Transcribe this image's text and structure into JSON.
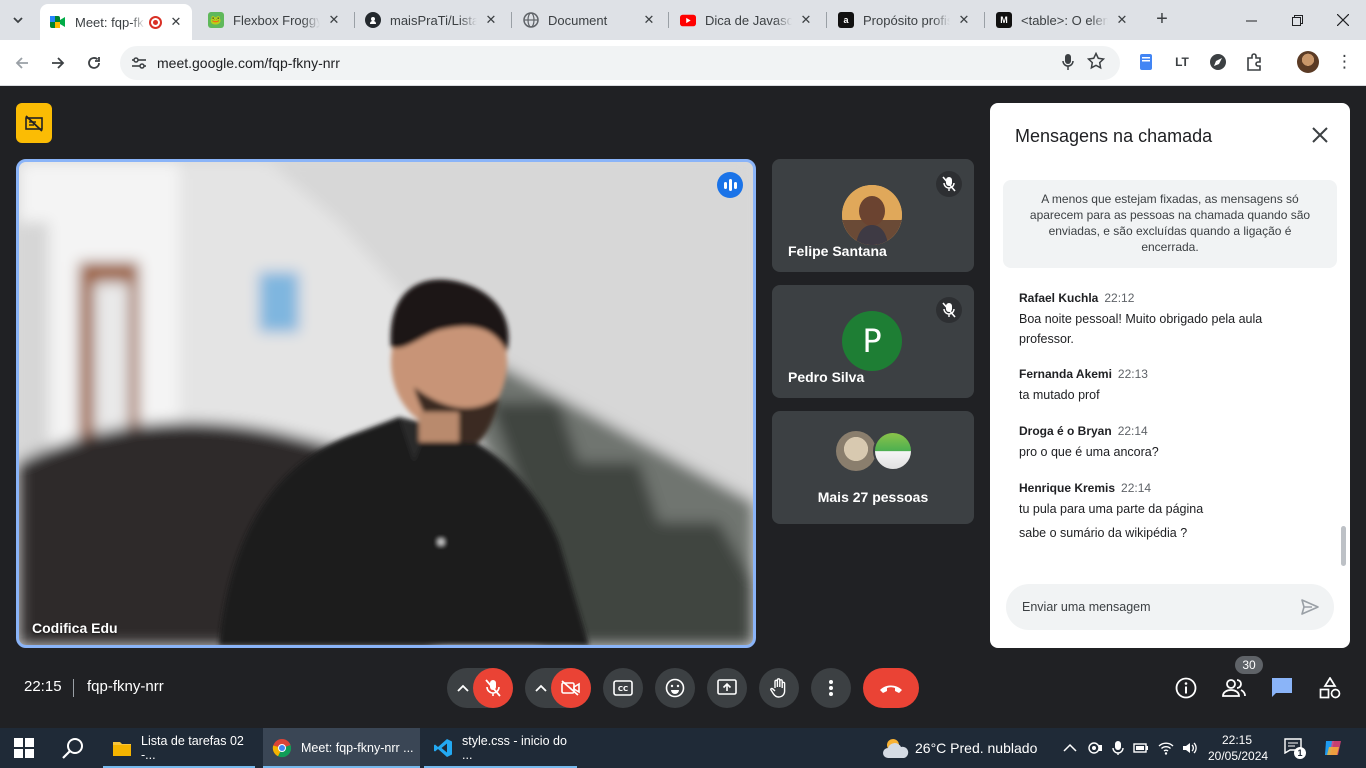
{
  "browser": {
    "tabs": [
      {
        "title": "Meet: fqp-fk",
        "favicon": "google-meet-icon",
        "active": true
      },
      {
        "title": "Flexbox Froggy",
        "favicon": "frog-icon"
      },
      {
        "title": "maisPraTi/Listas",
        "favicon": "github-icon"
      },
      {
        "title": "Document",
        "favicon": "globe-icon"
      },
      {
        "title": "Dica de Javascript",
        "favicon": "youtube-icon"
      },
      {
        "title": "Propósito profis",
        "favicon": "a-icon"
      },
      {
        "title": "<table>: O elem",
        "favicon": "mdn-icon"
      }
    ],
    "new_tab": "+",
    "url": "meet.google.com/fqp-fkny-nrr"
  },
  "meet": {
    "main_participant": "Codifica Edu",
    "participants": [
      {
        "name": "Felipe Santana",
        "muted": true
      },
      {
        "name": "Pedro Silva",
        "initial": "P",
        "muted": true,
        "avatar_color": "#1e7e34"
      }
    ],
    "more": "Mais 27 pessoas",
    "time": "22:15",
    "meeting_code": "fqp-fkny-nrr",
    "people_count": "30"
  },
  "chat": {
    "title": "Mensagens na chamada",
    "notice": "A menos que estejam fixadas, as mensagens só aparecem para as pessoas na chamada quando são enviadas, e são excluídas quando a ligação é encerrada.",
    "messages": [
      {
        "author": "Rafael Kuchla",
        "time": "22:12",
        "lines": [
          "Boa noite pessoal! Muito obrigado pela aula professor."
        ]
      },
      {
        "author": "Fernanda Akemi",
        "time": "22:13",
        "lines": [
          "ta mutado prof"
        ]
      },
      {
        "author": "Droga é o Bryan",
        "time": "22:14",
        "lines": [
          "pro o que é uma ancora?"
        ]
      },
      {
        "author": "Henrique Kremis",
        "time": "22:14",
        "lines": [
          "tu pula para uma parte da página",
          "sabe o sumário da wikipédia ?"
        ]
      }
    ],
    "input_placeholder": "Enviar uma mensagem"
  },
  "taskbar": {
    "apps": [
      {
        "label": "Lista de tarefas 02 -...",
        "icon": "folder-icon"
      },
      {
        "label": "Meet: fqp-fkny-nrr ...",
        "icon": "chrome-icon",
        "active": true
      },
      {
        "label": "style.css - inicio do ...",
        "icon": "vscode-icon"
      }
    ],
    "weather": "26°C  Pred. nublado",
    "time": "22:15",
    "date": "20/05/2024",
    "notifications": "1"
  },
  "colors": {
    "meet_bg": "#202124",
    "tile_bg": "#3c4043",
    "end_call": "#ea4335",
    "active_border": "#8ab4f8",
    "accent_blue": "#1a73e8"
  }
}
